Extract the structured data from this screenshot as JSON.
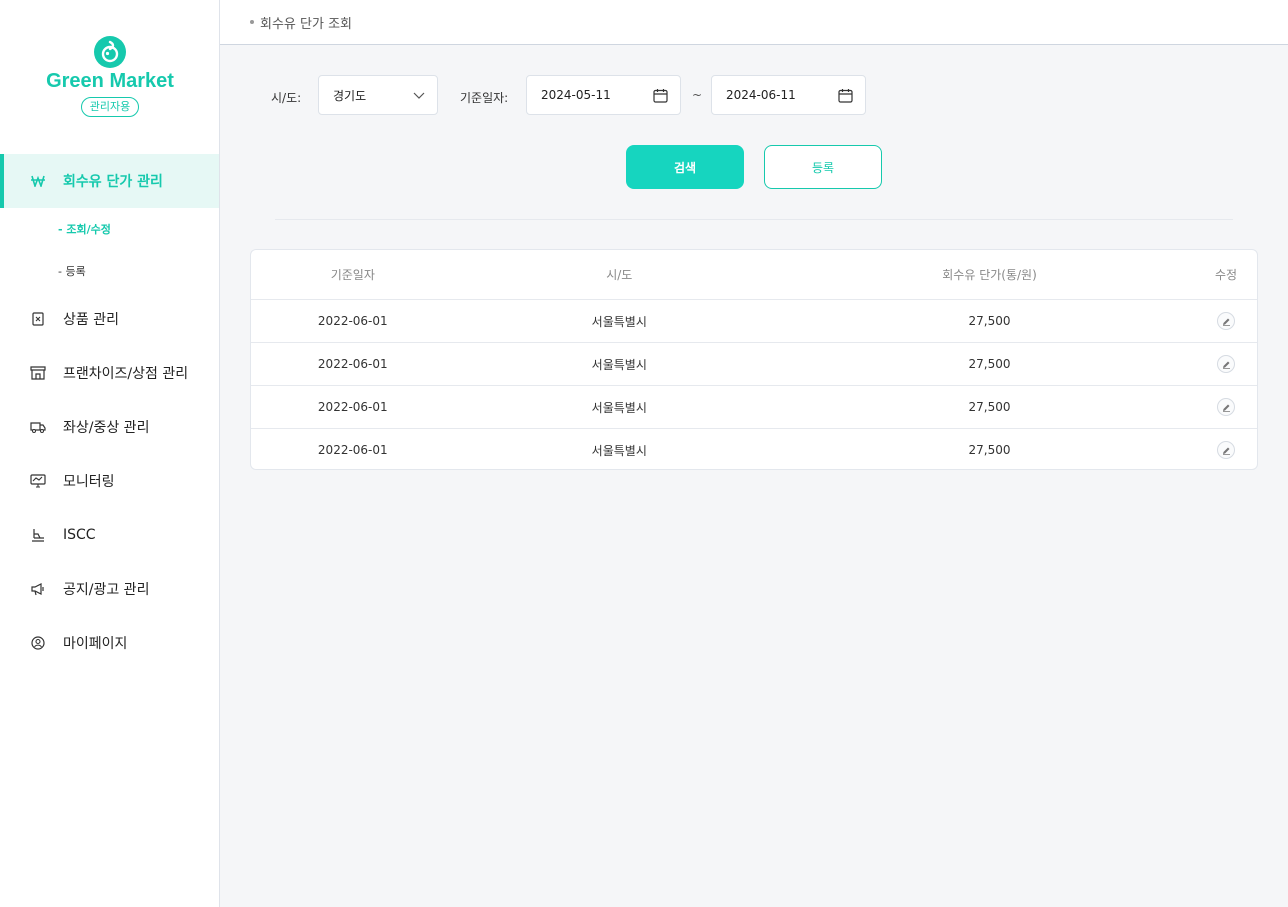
{
  "brand": {
    "name": "Green Market",
    "badge": "관리자용",
    "color": "#16c9ad"
  },
  "sidebar": {
    "items": [
      {
        "label": "회수유 단가 관리",
        "icon": "won-icon",
        "active": true
      },
      {
        "label": "상품 관리",
        "icon": "product-box-icon"
      },
      {
        "label": "프랜차이즈/상점 관리",
        "icon": "store-icon"
      },
      {
        "label": "좌상/중상 관리",
        "icon": "truck-icon"
      },
      {
        "label": "모니터링",
        "icon": "monitor-chart-icon"
      },
      {
        "label": "ISCC",
        "icon": "certificate-icon"
      },
      {
        "label": "공지/광고 관리",
        "icon": "megaphone-icon"
      },
      {
        "label": "마이페이지",
        "icon": "user-circle-icon"
      }
    ],
    "sub_items": [
      {
        "label": "- 조회/수정",
        "active": true
      },
      {
        "label": "- 등록"
      }
    ]
  },
  "breadcrumb": {
    "title": "회수유 단가 조회"
  },
  "filters": {
    "region_label": "시/도:",
    "region_value": "경기도",
    "date_label": "기준일자:",
    "date_from": "2024-05-11",
    "date_to": "2024-06-11",
    "range_separator": "~"
  },
  "actions": {
    "search": "검색",
    "register": "등록"
  },
  "table": {
    "columns": [
      "기준일자",
      "시/도",
      "회수유 단가(통/원)",
      "수정"
    ],
    "rows": [
      [
        "2022-06-01",
        "서울특별시",
        "27,500"
      ],
      [
        "2022-06-01",
        "서울특별시",
        "27,500"
      ],
      [
        "2022-06-01",
        "서울특별시",
        "27,500"
      ],
      [
        "2022-06-01",
        "서울특별시",
        "27,500"
      ]
    ]
  }
}
